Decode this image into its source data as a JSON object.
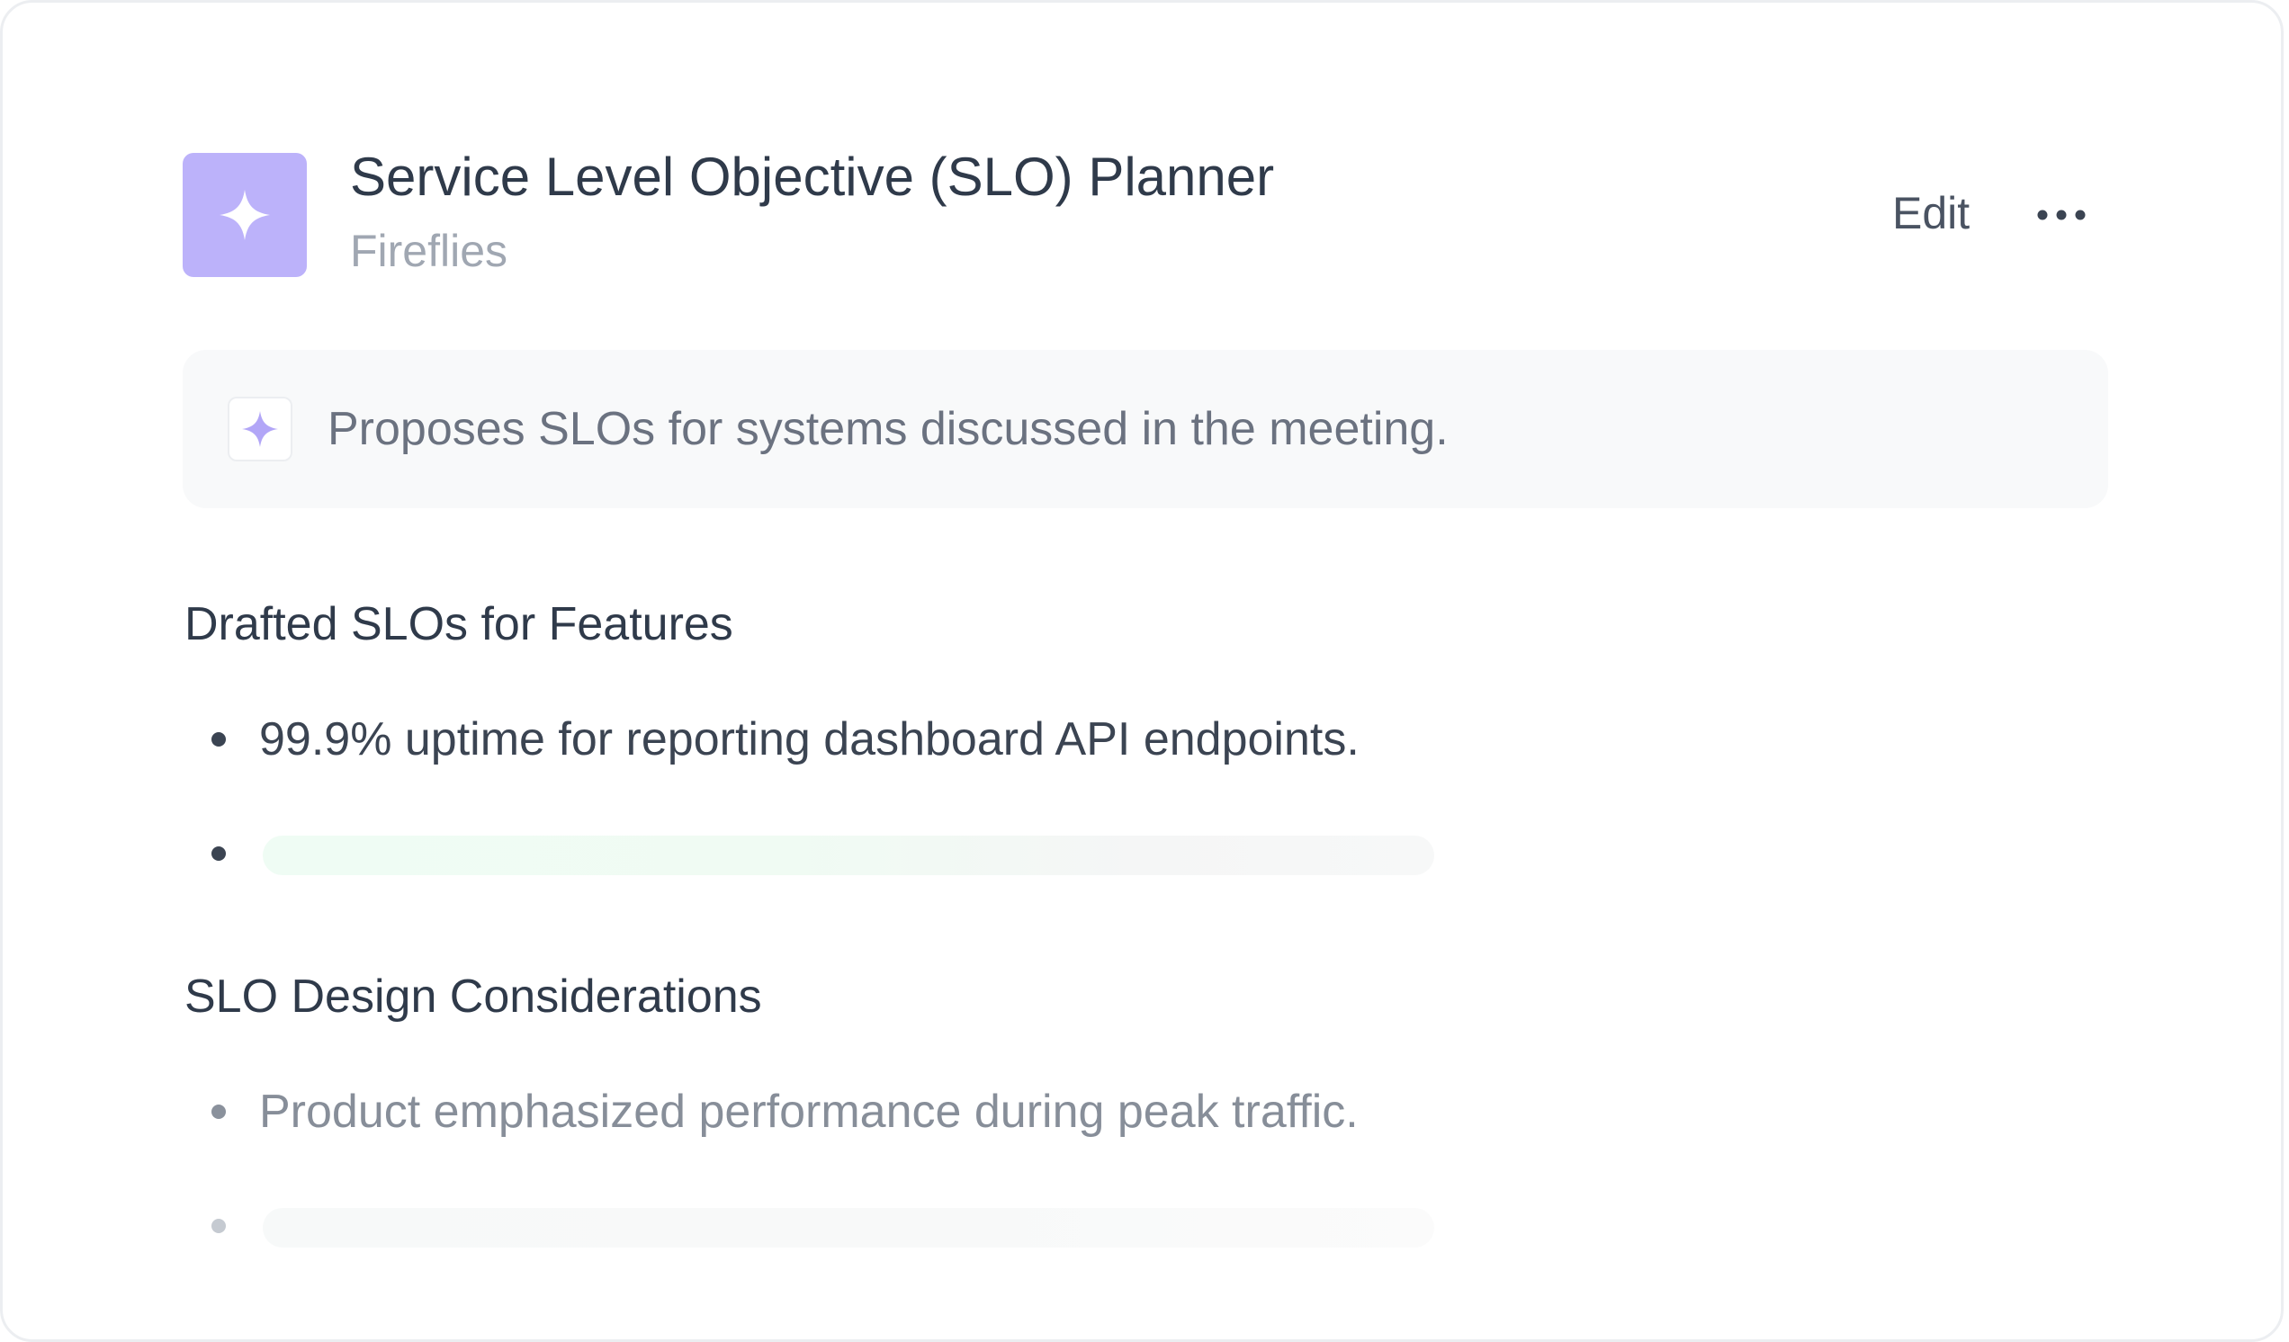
{
  "header": {
    "title": "Service Level Objective (SLO) Planner",
    "subtitle": "Fireflies",
    "app_icon": "sparkle-icon",
    "edit_label": "Edit",
    "more_icon": "more-horizontal-icon"
  },
  "description": {
    "icon": "sparkle-icon",
    "text": "Proposes SLOs for systems discussed in the meeting."
  },
  "sections": [
    {
      "title": "Drafted SLOs for Features",
      "items": [
        {
          "text": "99.9% uptime for reporting dashboard API endpoints."
        }
      ]
    },
    {
      "title": "SLO Design Considerations",
      "items": [
        {
          "text": "Product emphasized performance during peak traffic."
        }
      ]
    }
  ],
  "colors": {
    "accent": "#bcb2fa",
    "accent_icon": "#b2a6f7",
    "text_primary": "#2f3a4a",
    "text_muted": "#a0a7b2",
    "skeleton_green": "#effcf4"
  }
}
